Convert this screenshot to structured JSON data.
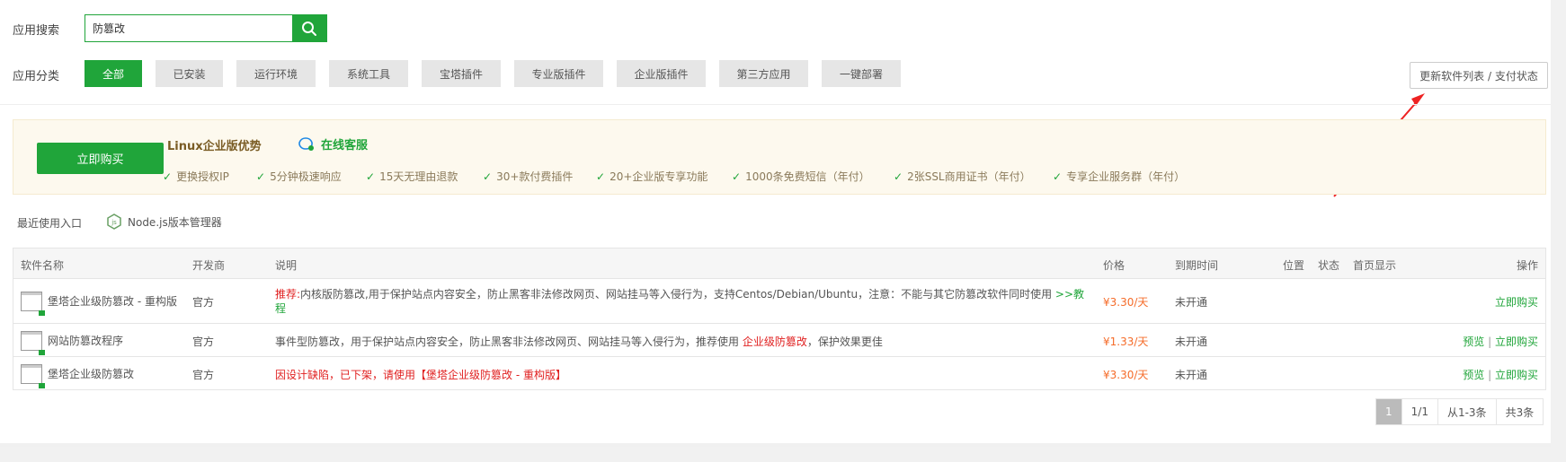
{
  "search": {
    "label": "应用搜索",
    "value": "防篡改"
  },
  "category": {
    "label": "应用分类",
    "items": [
      "全部",
      "已安装",
      "运行环境",
      "系统工具",
      "宝塔插件",
      "专业版插件",
      "企业版插件",
      "第三方应用",
      "一键部署"
    ],
    "active_index": 0
  },
  "refresh_label": "更新软件列表 / 支付状态",
  "promo": {
    "buy_label": "立即购买",
    "title": "Linux企业版优势",
    "service_label": "在线客服",
    "features": [
      "更换授权IP",
      "5分钟极速响应",
      "15天无理由退款",
      "30+款付费插件",
      "20+企业版专享功能",
      "1000条免费短信（年付）",
      "2张SSL商用证书（年付）",
      "专享企业服务群（年付）"
    ]
  },
  "recent": {
    "label": "最近使用入口",
    "item": "Node.js版本管理器"
  },
  "table": {
    "headers": {
      "name": "软件名称",
      "dev": "开发商",
      "desc": "说明",
      "price": "价格",
      "expire": "到期时间",
      "location": "位置",
      "status": "状态",
      "home": "首页显示",
      "action": "操作"
    },
    "rows": [
      {
        "name": "堡塔企业级防篡改 - 重构版",
        "dev": "官方",
        "desc_prefix": "推荐:",
        "desc": "内核版防篡改,用于保护站点内容安全，防止黑客非法修改网页、网站挂马等入侵行为，支持Centos/Debian/Ubuntu，注意：不能与其它防篡改软件同时使用",
        "desc_link": ">>教程",
        "price": "¥3.30/天",
        "expire": "未开通",
        "action_buy": "立即购买"
      },
      {
        "name": "网站防篡改程序",
        "dev": "官方",
        "desc": "事件型防篡改，用于保护站点内容安全，防止黑客非法修改网页、网站挂马等入侵行为，推荐使用",
        "desc_link": "企业级防篡改",
        "desc_suffix": "，保护效果更佳",
        "price": "¥1.33/天",
        "expire": "未开通",
        "action_preview": "预览",
        "action_sep": "|",
        "action_buy": "立即购买"
      },
      {
        "name": "堡塔企业级防篡改",
        "dev": "官方",
        "desc": "因设计缺陷，已下架，请使用【堡塔企业级防篡改 - 重构版】",
        "price": "¥3.30/天",
        "expire": "未开通",
        "action_preview": "预览",
        "action_sep": "|",
        "action_buy": "立即购买"
      }
    ]
  },
  "pager": {
    "current": "1",
    "pages": "1/1",
    "range": "从1-3条",
    "total": "共3条"
  },
  "colors": {
    "brand": "#20a53a",
    "price": "#f56c2a",
    "alert": "#e02020"
  }
}
